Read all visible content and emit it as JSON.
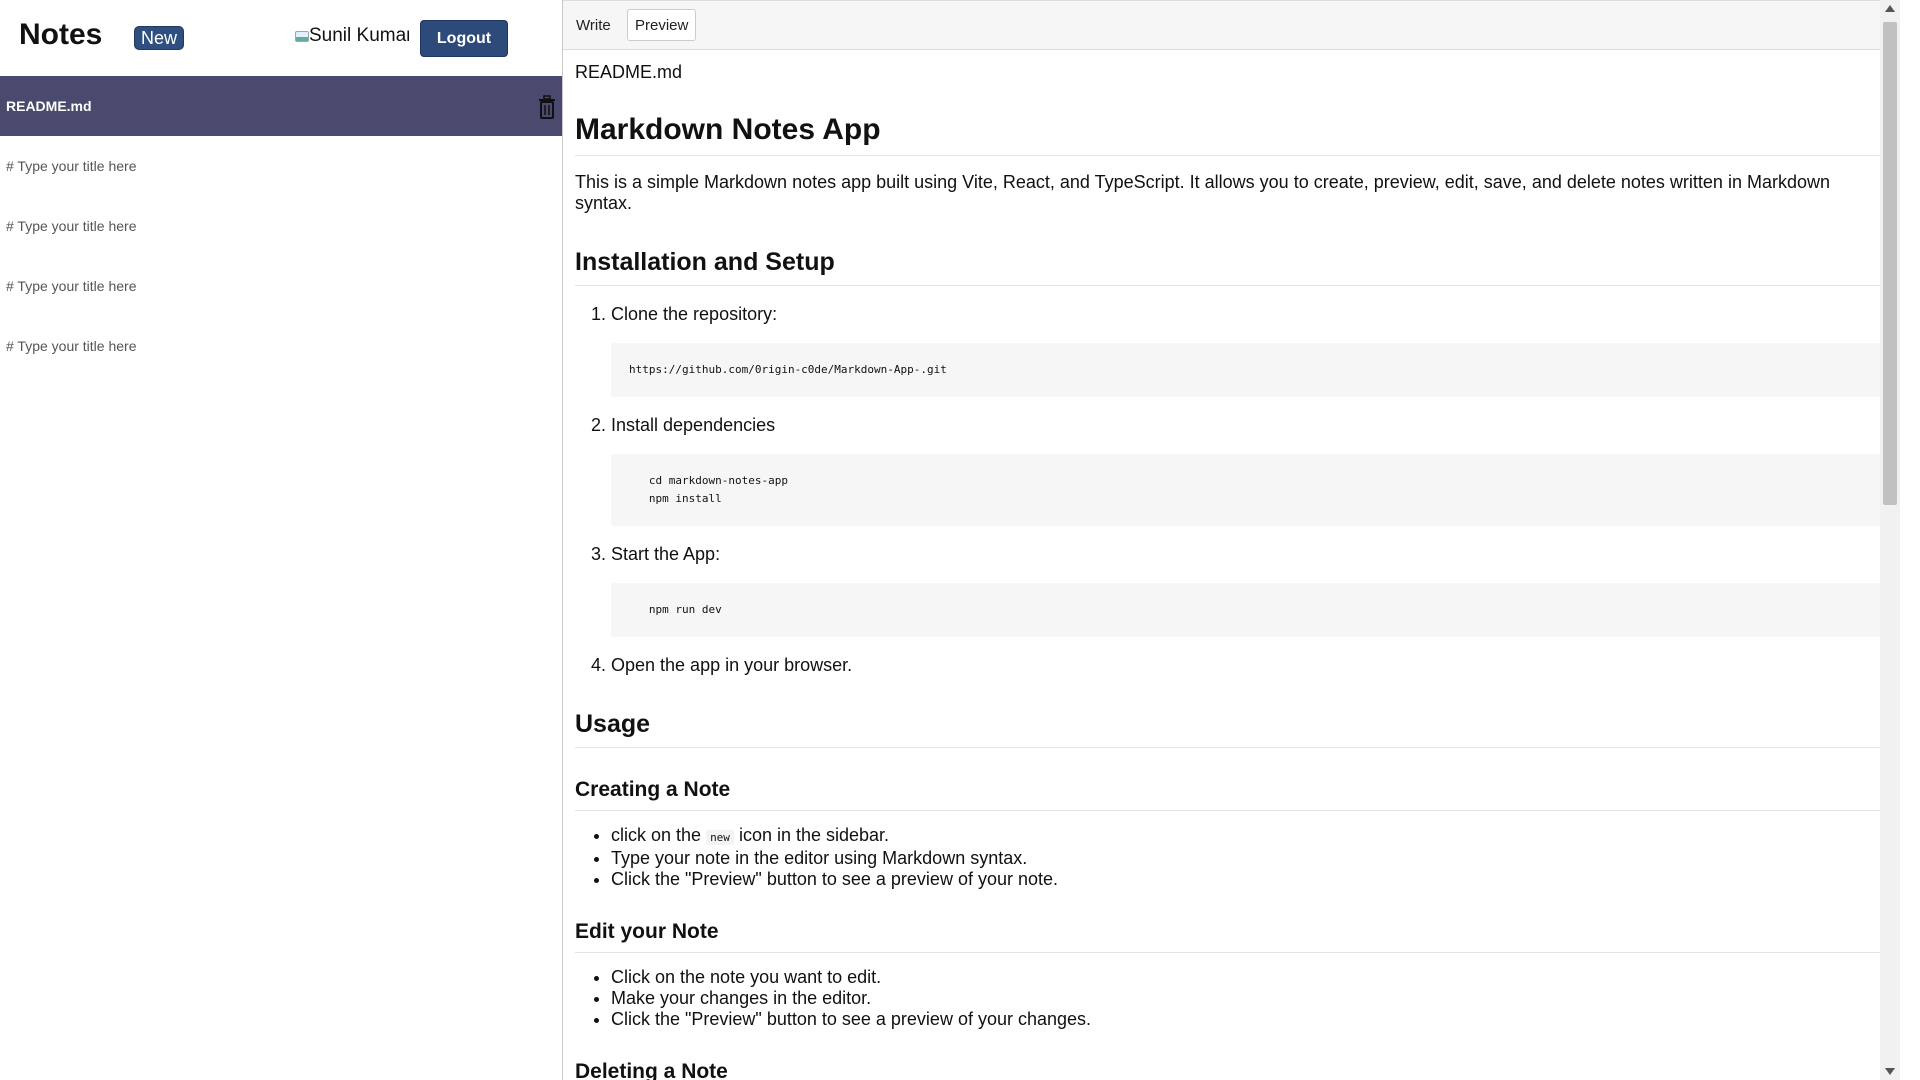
{
  "sidebar": {
    "app_title": "Notes",
    "new_label": "New",
    "user_name": "Sunil Kumar",
    "logout_label": "Logout",
    "notes": [
      {
        "title": "README.md",
        "active": true
      },
      {
        "title": "# Type your title here",
        "active": false
      },
      {
        "title": "# Type your title here",
        "active": false
      },
      {
        "title": "# Type your title here",
        "active": false
      },
      {
        "title": "# Type your title here",
        "active": false
      }
    ]
  },
  "tabs": {
    "write": "Write",
    "preview": "Preview",
    "active": "Preview"
  },
  "preview": {
    "filename": "README.md",
    "title": "Markdown Notes App",
    "description": "This is a simple Markdown notes app built using Vite, React, and TypeScript. It allows you to create, preview, edit, save, and delete notes written in Markdown syntax.",
    "install_heading": "Installation and Setup",
    "steps": [
      {
        "label": "Clone the repository:",
        "code": "https://github.com/0rigin-c0de/Markdown-App-.git"
      },
      {
        "label": "Install dependencies",
        "code": "   cd markdown-notes-app\n   npm install"
      },
      {
        "label": "Start the App:",
        "code": "   npm run dev"
      },
      {
        "label": "Open the app in your browser."
      }
    ],
    "usage_heading": "Usage",
    "creating_heading": "Creating a Note",
    "creating_items": {
      "item1_before": "click on the",
      "item1_code": "new",
      "item1_after": "icon in the sidebar.",
      "item2": "Type your note in the editor using Markdown syntax.",
      "item3": "Click the \"Preview\" button to see a preview of your note."
    },
    "edit_heading": "Edit your Note",
    "edit_items": [
      "Click on the note you want to edit.",
      "Make your changes in the editor.",
      "Click the \"Preview\" button to see a preview of your changes."
    ],
    "delete_heading": "Deleting a Note"
  },
  "colors": {
    "active_note_bg": "#4a4a6e",
    "button_blue": "#2e4a7a"
  },
  "icons": {
    "delete": "trash-icon",
    "avatar": "broken-image-icon"
  }
}
